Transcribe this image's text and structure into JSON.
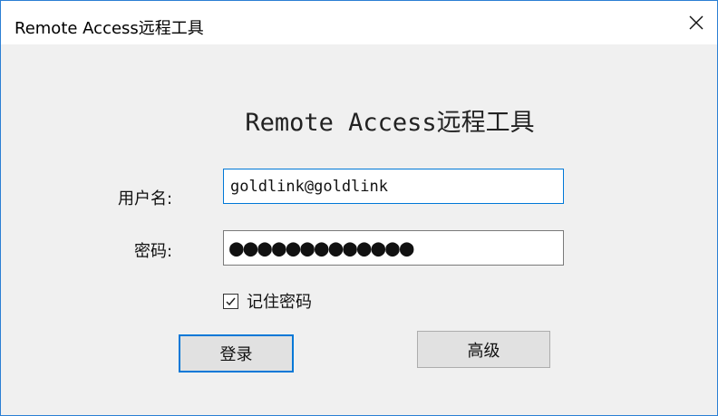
{
  "window": {
    "title": "Remote Access远程工具",
    "close_icon": "close-icon",
    "accent_color": "#0078d7"
  },
  "heading": "Remote Access远程工具",
  "form": {
    "username_label": "用户名:",
    "username_value": "goldlink@goldlink",
    "password_label": "密码:",
    "password_value": "●●●●●●●●●●●●●",
    "remember_label": "记住密码",
    "remember_checked": true,
    "checkbox_icon": "checkmark-icon"
  },
  "buttons": {
    "login_label": "登录",
    "advanced_label": "高级"
  }
}
